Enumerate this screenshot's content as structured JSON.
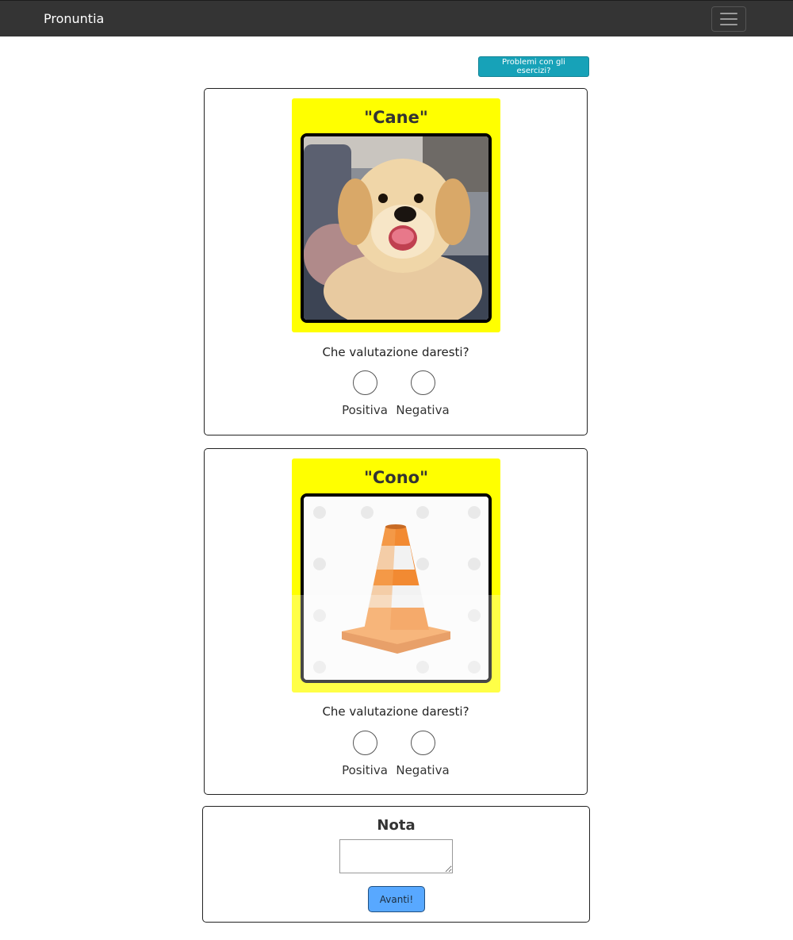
{
  "app": {
    "title": "Pronuntia"
  },
  "navbar": {
    "brand": "Pronuntia",
    "menu_icon": "hamburger-menu-icon"
  },
  "help_button": {
    "label": "Problemi con gli esercizi?"
  },
  "exercises": [
    {
      "word": "\"Cane\"",
      "image": "puppy-photo",
      "question": "Che valutazione daresti?",
      "options": [
        "Positiva",
        "Negativa"
      ]
    },
    {
      "word": "\"Cono\"",
      "image": "traffic-cone-illustration",
      "question": "Che valutazione daresti?",
      "options": [
        "Positiva",
        "Negativa"
      ]
    }
  ],
  "note": {
    "title": "Nota",
    "textarea_value": "",
    "submit_label": "Avanti!"
  },
  "colors": {
    "navbar": "#343434",
    "word_card": "#ffff00",
    "help_button": "#17a2b8",
    "submit_button": "#58a8ff"
  }
}
